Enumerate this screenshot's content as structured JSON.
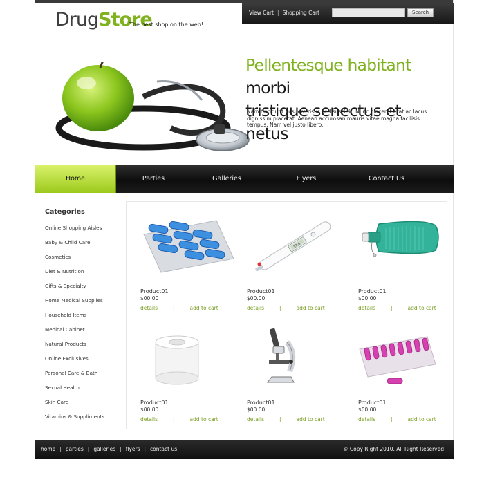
{
  "brand": {
    "name_part1": "Drug",
    "name_part2": "Store",
    "tagline": "The best shop on the web!",
    "accent_color": "#7fb21e"
  },
  "top_links": {
    "view_cart": "View Cart",
    "separator": "|",
    "shopping_cart": "Shopping Cart"
  },
  "search": {
    "value": "",
    "placeholder": "",
    "button_label": "Search"
  },
  "hero": {
    "headline_green": "Pellentesque habitant",
    "headline_dark1": "morbi",
    "headline_dark2": "tristique senectus et netus",
    "body": "Nam tincidunt posuere risus sed suscipit. Nunc placerat erat ac lacus dignissim placerat. Aenean accumsan mauris vitae magna facilisis tempus. Nam vel justo libero.",
    "image_icon": "apple-stethoscope-image"
  },
  "nav": {
    "items": [
      {
        "label": "Home",
        "active": true
      },
      {
        "label": "Parties",
        "active": false
      },
      {
        "label": "Galleries",
        "active": false
      },
      {
        "label": "Flyers",
        "active": false
      },
      {
        "label": "Contact Us",
        "active": false
      }
    ]
  },
  "categories": {
    "title": "Categories",
    "items": [
      "Online Shopping Aisles",
      "Baby & Child Care",
      "Cosmetics",
      "Diet & Nutrition",
      "Gifts & Specialty",
      "Home Medical Supplies",
      "Household Items",
      "Medical Cabinet",
      "Natural Products",
      "Online Exclusives",
      "Personal Care & Bath",
      "Sexual Health",
      "Skin Care",
      "Vitamins & Suppliments"
    ]
  },
  "products": [
    {
      "name": "Product01",
      "price": "$00.00",
      "details": "details",
      "sep": "|",
      "add": "add to cart",
      "icon": "blue-pills-blister-icon"
    },
    {
      "name": "Product01",
      "price": "$00.00",
      "details": "details",
      "sep": "|",
      "add": "add to cart",
      "icon": "thermometer-icon"
    },
    {
      "name": "Product01",
      "price": "$00.00",
      "details": "details",
      "sep": "|",
      "add": "add to cart",
      "icon": "hot-water-bottle-icon"
    },
    {
      "name": "Product01",
      "price": "$00.00",
      "details": "details",
      "sep": "|",
      "add": "add to cart",
      "icon": "bandage-tape-roll-icon"
    },
    {
      "name": "Product01",
      "price": "$00.00",
      "details": "details",
      "sep": "|",
      "add": "add to cart",
      "icon": "microscope-icon"
    },
    {
      "name": "Product01",
      "price": "$00.00",
      "details": "details",
      "sep": "|",
      "add": "add to cart",
      "icon": "pink-pills-blister-icon"
    }
  ],
  "footer": {
    "links": [
      "home",
      "parties",
      "galleries",
      "flyers",
      "contact us"
    ],
    "separator": "|",
    "copyright": "© Copy Right 2010. All Right Reserved"
  }
}
